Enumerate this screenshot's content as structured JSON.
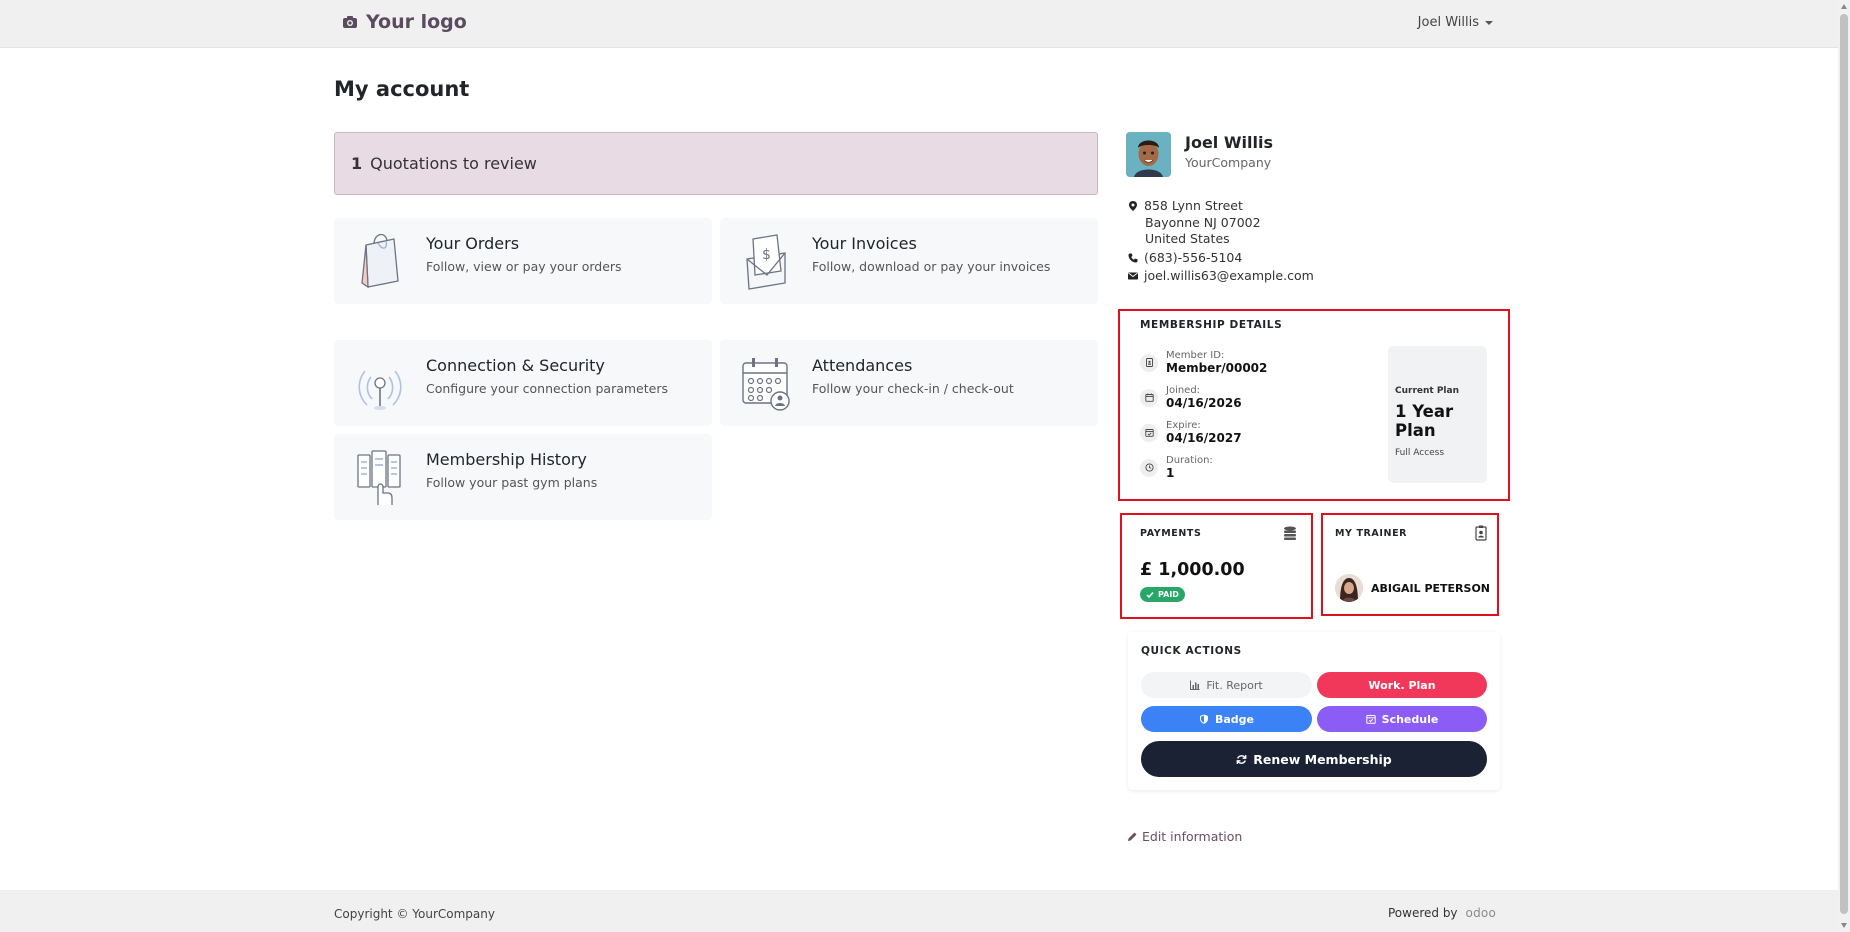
{
  "navbar": {
    "logo_text": "Your logo",
    "user_name": "Joel Willis"
  },
  "page": {
    "title": "My account"
  },
  "alert": {
    "count": "1",
    "text": "Quotations to review"
  },
  "cards": [
    {
      "title": "Your Orders",
      "desc": "Follow, view or pay your orders"
    },
    {
      "title": "Your Invoices",
      "desc": "Follow, download or pay your invoices"
    },
    {
      "title": "Connection & Security",
      "desc": "Configure your connection parameters"
    },
    {
      "title": "Attendances",
      "desc": "Follow your check-in / check-out"
    },
    {
      "title": "Membership History",
      "desc": "Follow your past gym plans"
    }
  ],
  "profile": {
    "name": "Joel Willis",
    "company": "YourCompany",
    "address_line1": "858 Lynn Street",
    "address_line2": "Bayonne NJ 07002",
    "address_line3": "United States",
    "phone": "(683)-556-5104",
    "email": "joel.willis63@example.com"
  },
  "membership": {
    "title": "MEMBERSHIP DETAILS",
    "member_id_label": "Member ID:",
    "member_id": "Member/00002",
    "joined_label": "Joined:",
    "joined": "04/16/2026",
    "expire_label": "Expire:",
    "expire": "04/16/2027",
    "duration_label": "Duration:",
    "duration": "1",
    "plan_label": "Current Plan",
    "plan_value": "1 Year Plan",
    "plan_access": "Full Access"
  },
  "payments": {
    "title": "PAYMENTS",
    "amount": "£ 1,000.00",
    "status": "PAID"
  },
  "trainer": {
    "title": "MY TRAINER",
    "name": "ABIGAIL PETERSON"
  },
  "quick_actions": {
    "title": "QUICK ACTIONS",
    "fit_report": "Fit. Report",
    "work_plan": "Work. Plan",
    "badge": "Badge",
    "schedule": "Schedule",
    "renew": "Renew Membership"
  },
  "edit_link": "Edit information",
  "footer": {
    "copyright": "Copyright © YourCompany",
    "powered_by": "Powered by",
    "brand": "odoo"
  },
  "colors": {
    "highlight_border": "#e0111c",
    "paid_badge": "#28a769",
    "work_plan": "#f1375a",
    "badge_btn": "#3b82f6",
    "schedule_btn": "#8b5cf6",
    "renew_btn": "#1a2233",
    "alert_bg": "#e8dbe4"
  }
}
